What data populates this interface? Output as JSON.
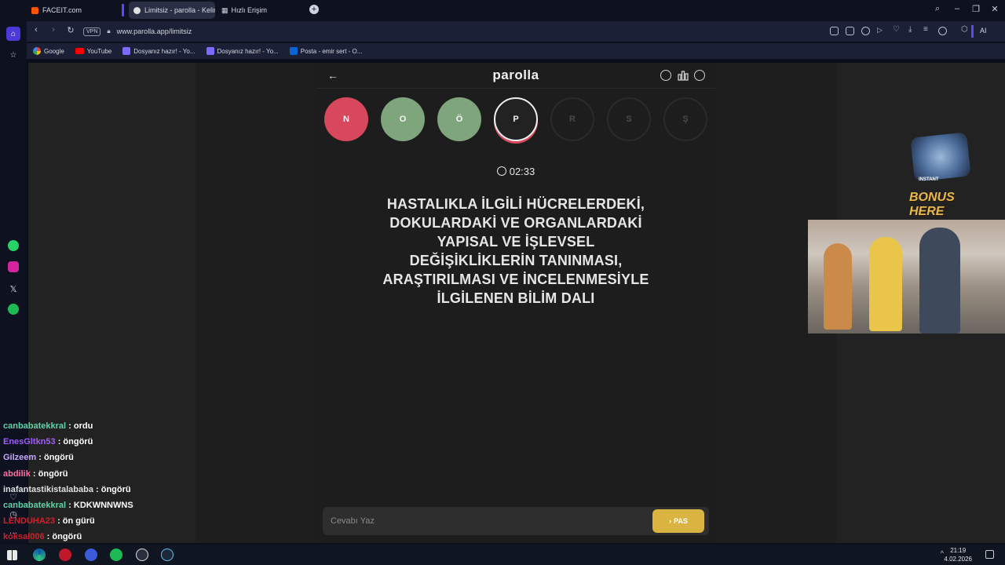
{
  "browser": {
    "tabs": [
      {
        "label": "FACEIT.com",
        "active": false
      },
      {
        "label": "Limitsiz - parolla - Kelime",
        "active": true
      },
      {
        "label": "Hızlı Erişim",
        "active": false
      }
    ],
    "url": "www.parolla.app/limitsiz",
    "vpn_label": "VPN",
    "ai_label": "AI",
    "bookmarks": [
      "Google",
      "YouTube",
      "Dosyanız hazır! - Yo...",
      "Dosyanız hazır! - Yo...",
      "Posta - emir sert - O..."
    ]
  },
  "app": {
    "logo": "parolla",
    "letters": [
      {
        "char": "N",
        "state": "wrong",
        "color": "#d8485c"
      },
      {
        "char": "O",
        "state": "correct",
        "color": "#7fa57c"
      },
      {
        "char": "Ö",
        "state": "correct",
        "color": "#7fa57c"
      },
      {
        "char": "P",
        "state": "current",
        "color": "#222222"
      },
      {
        "char": "R",
        "state": "pending",
        "color": "#1d1d1d"
      },
      {
        "char": "S",
        "state": "pending",
        "color": "#1d1d1d"
      },
      {
        "char": "Ş",
        "state": "pending",
        "color": "#1d1d1d"
      }
    ],
    "timer": "02:33",
    "question_lines": [
      "HASTALIKLA İLGİLİ HÜCRELERDEKİ,",
      "DOKULARDAKİ VE ORGANLARDAKİ",
      "YAPISAL VE İŞLEVSEL",
      "DEĞİŞİKLİKLERİN TANINMASI,",
      "ARAŞTIRILMASI VE İNCELENMESİYLE",
      "İLGİLENEN BİLİM DALI"
    ],
    "answer_placeholder": "Cevabı Yaz",
    "pass_label": "PAS"
  },
  "overlay": {
    "bonus_small": "INSTANT",
    "bonus_text": "BONUS HERE"
  },
  "chat": [
    {
      "user": "canbabatekkral",
      "text": "ordu",
      "color": "#5fd3a8"
    },
    {
      "user": "EnesGltkn53",
      "text": "öngörü",
      "color": "#a05cff"
    },
    {
      "user": "Gilzeem",
      "text": "öngörü",
      "color": "#c9a6ff"
    },
    {
      "user": "abdilik",
      "text": "öngörü",
      "color": "#ff6fa0"
    },
    {
      "user": "inafantastikistalababa",
      "text": "öngörü",
      "color": "#e0e0e0"
    },
    {
      "user": "canbabatekkral",
      "text": "KDKWNNWNS",
      "color": "#5fd3a8"
    },
    {
      "user": "LENDUHA23",
      "text": "ön gürü",
      "color": "#d0202c"
    },
    {
      "user": "koksal006",
      "text": "öngörü",
      "color": "#d0202c"
    }
  ],
  "taskbar": {
    "time": "21:19",
    "date": "4.02.2026"
  }
}
